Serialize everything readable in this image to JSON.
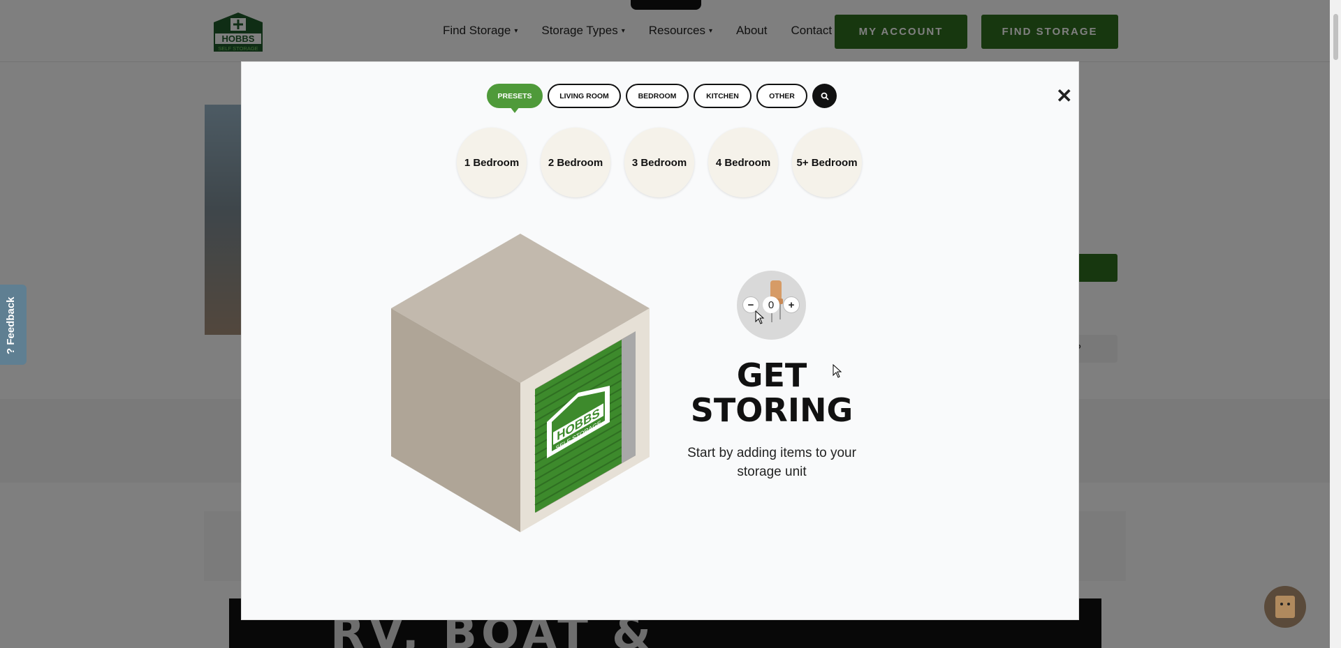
{
  "header": {
    "logo": {
      "line1": "HOBBS",
      "line2": "SELF STORAGE"
    },
    "nav": [
      {
        "label": "Find Storage",
        "has_caret": true
      },
      {
        "label": "Storage Types",
        "has_caret": true
      },
      {
        "label": "Resources",
        "has_caret": true
      },
      {
        "label": "About",
        "has_caret": false
      },
      {
        "label": "Contact",
        "has_caret": false
      }
    ],
    "account_label": "MY ACCOUNT",
    "find_label": "FIND STORAGE"
  },
  "background": {
    "partial_text": "eed?",
    "banner_text": "RV, BOAT &"
  },
  "feedback": {
    "label": "? Feedback"
  },
  "modal": {
    "tabs": [
      {
        "label": "PRESETS",
        "active": true
      },
      {
        "label": "LIVING ROOM",
        "active": false
      },
      {
        "label": "BEDROOM",
        "active": false
      },
      {
        "label": "KITCHEN",
        "active": false
      },
      {
        "label": "OTHER",
        "active": false
      }
    ],
    "search_icon": "search-icon",
    "close_icon": "close-icon",
    "presets": [
      "1 Bedroom",
      "2 Bedroom",
      "3 Bedroom",
      "4 Bedroom",
      "5+ Bedroom"
    ],
    "counter": {
      "minus": "−",
      "value": "0",
      "plus": "+"
    },
    "unit_door": {
      "line1": "HOBBS",
      "line2": "SELF STORAGE"
    },
    "headline_line1": "GET",
    "headline_line2": "STORING",
    "subtext": "Start by adding items to your storage unit"
  },
  "colors": {
    "brand_green": "#2f6f1e",
    "tab_active": "#4f9a3a",
    "door_green": "#3d8a2c"
  }
}
